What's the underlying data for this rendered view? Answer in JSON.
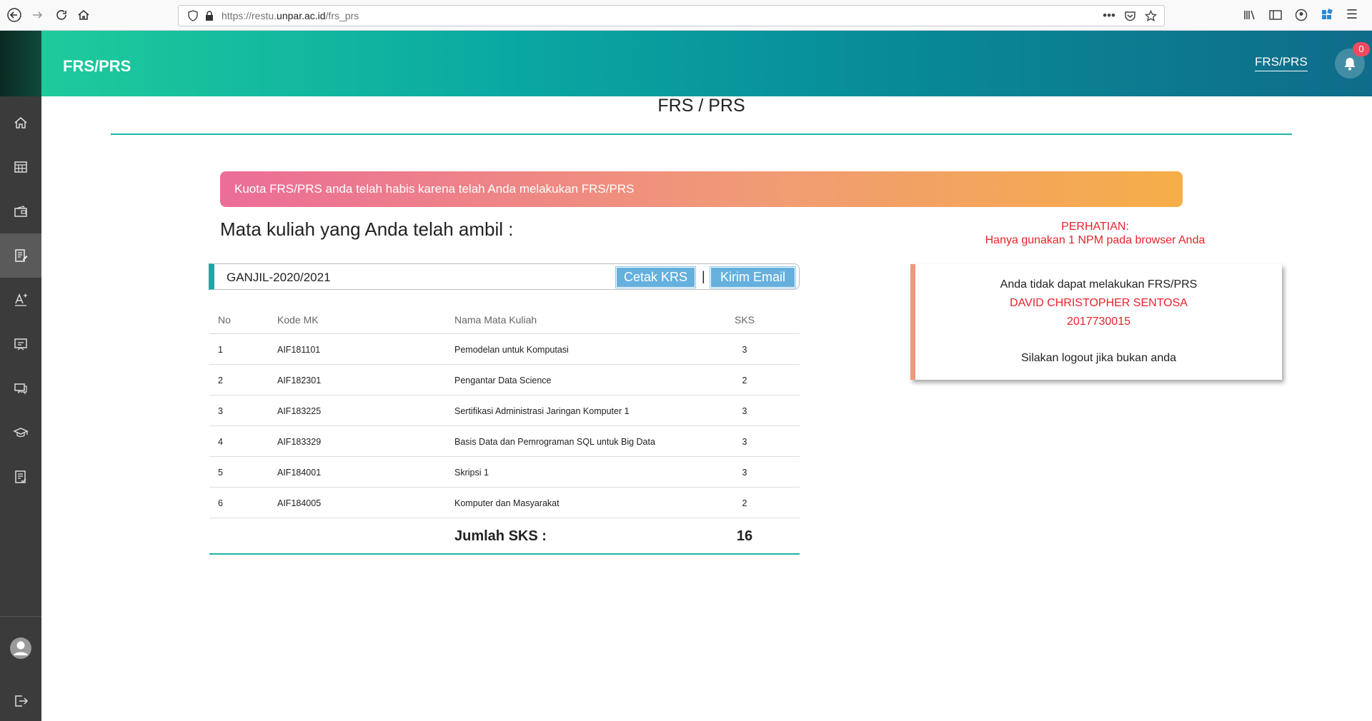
{
  "browser": {
    "url_prefix": "https://restu.",
    "url_domain": "unpar.ac.id",
    "url_path": "/frs_prs"
  },
  "header": {
    "app_title": "FRS/PRS",
    "nav_link": "FRS/PRS",
    "notification_count": "0"
  },
  "page": {
    "title": "FRS / PRS",
    "alert": "Kuota FRS/PRS anda telah habis karena telah Anda melakukan FRS/PRS",
    "section_heading": "Mata kuliah yang Anda telah ambil :"
  },
  "notice": {
    "line1": "PERHATIAN:",
    "line2": "Hanya gunakan 1 NPM pada browser Anda"
  },
  "term": {
    "label": "GANJIL-2020/2021",
    "print_button": "Cetak KRS",
    "separator": "|",
    "email_button": "Kirim Email"
  },
  "table": {
    "headers": {
      "no": "No",
      "kode": "Kode MK",
      "nama": "Nama Mata Kuliah",
      "sks": "SKS"
    },
    "rows": [
      {
        "no": "1",
        "kode": "AIF181101",
        "nama": "Pemodelan untuk Komputasi",
        "sks": "3"
      },
      {
        "no": "2",
        "kode": "AIF182301",
        "nama": "Pengantar Data Science",
        "sks": "2"
      },
      {
        "no": "3",
        "kode": "AIF183225",
        "nama": "Sertifikasi Administrasi Jaringan Komputer 1",
        "sks": "3"
      },
      {
        "no": "4",
        "kode": "AIF183329",
        "nama": "Basis Data dan Pemrograman SQL untuk Big Data",
        "sks": "3"
      },
      {
        "no": "5",
        "kode": "AIF184001",
        "nama": "Skripsi 1",
        "sks": "3"
      },
      {
        "no": "6",
        "kode": "AIF184005",
        "nama": "Komputer dan Masyarakat",
        "sks": "2"
      }
    ],
    "total_label": "Jumlah SKS :",
    "total_value": "16"
  },
  "info_card": {
    "line1": "Anda tidak dapat melakukan FRS/PRS",
    "name": "DAVID CHRISTOPHER SENTOSA",
    "npm": "2017730015",
    "logout_hint": "Silakan logout jika bukan anda"
  },
  "colors": {
    "accent": "#1cb5a6",
    "alert_start": "#eb6d98",
    "alert_end": "#f5ae48",
    "warning_text": "#e8242b",
    "sidebar": "#3b3b3b"
  }
}
